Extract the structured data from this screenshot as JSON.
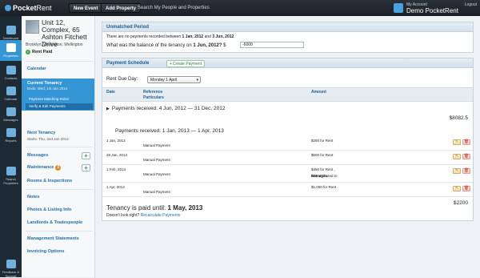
{
  "topbar": {
    "brand_name": "Pocket",
    "brand_suffix": "Rent",
    "new_event": "New Event",
    "add_property": "Add Property",
    "search_placeholder": "Search My People and Properties",
    "account_label": "My Account",
    "account_name": "Demo PocketRent",
    "logout": "Logout"
  },
  "left_nav": [
    {
      "label": "Dashboard",
      "icon": "dashboard-icon"
    },
    {
      "label": "Properties",
      "icon": "building-icon"
    },
    {
      "label": "Contacts",
      "icon": "people-icon"
    },
    {
      "label": "Calendar",
      "icon": "calendar-icon"
    },
    {
      "label": "Messages",
      "icon": "speech-bubble-icon"
    },
    {
      "label": "Reports",
      "icon": "chart-icon"
    },
    {
      "label": "Search Properties",
      "icon": "search-icon"
    },
    {
      "label": "Feedback & Support",
      "icon": "flag-icon"
    }
  ],
  "sidebar": {
    "property_title": "Unit 12, Complex, 65 Ashton Fitchett Drive",
    "property_address": "Brooklyn, Wellington, Wellington",
    "rent_status": "Rent Paid",
    "calendar": "Calendar",
    "current_tenancy": "Current Tenancy",
    "current_tenancy_ends": "Ends: Wed, 1st Jan 2014",
    "sub_payment_matching": "Payment Matching Rules",
    "sub_verify_edit": "Verify & Edit Payments",
    "next_tenancy": "Next Tenancy",
    "next_tenancy_starts": "Starts: Thu, 2nd Jan 2014",
    "messages": "Messages",
    "maintenance": "Maintenance",
    "maintenance_count": "2",
    "rooms_inspections": "Rooms & Inspections",
    "notes": "Notes",
    "photos_listing": "Photos & Listing Info",
    "landlords_tradespeople": "Landlords & Tradespeople",
    "management_statements": "Management Statements",
    "invoicing_options": "Invoicing Options"
  },
  "unmatched": {
    "title": "Unmatched Period",
    "notice_prefix": "There are no payments recorded between",
    "notice_from": "1 Jan, 2012",
    "notice_and": "and",
    "notice_to": "3 Jun, 2012",
    "question_prefix": "What was the balance of the tenancy on",
    "question_date": "1 Jun, 2012?",
    "currency": "$",
    "balance_value": "-6000"
  },
  "schedule": {
    "title": "Payment Schedule",
    "create_payment": "Create Payment",
    "rent_due_label": "Rent Due Day:",
    "rent_due_value": "Monday 1 April",
    "col_date": "Date",
    "col_reference": "Reference",
    "col_particulars": "Particulars",
    "col_amount": "Amount",
    "group1_label": "Payments received: 4 Jun, 2012 — 31 Dec, 2012",
    "group1_total": "$8082.5",
    "group2_label": "Payments received: 1 Jan, 2013 — 1 Apr, 2013",
    "rows": [
      {
        "date": "1 Jan, 2013",
        "particulars": "Manual Payment",
        "amount": "$250 for Rent",
        "amount_extra_prefix": "",
        "amount_extra_bold": ""
      },
      {
        "date": "28 Jan, 2013",
        "particulars": "Manual Payment",
        "amount": "$500 for Rent",
        "amount_extra_prefix": "",
        "amount_extra_bold": ""
      },
      {
        "date": "1 Feb, 2013",
        "particulars": "Manual Payment",
        "amount": "$450 for Rent ,",
        "amount_extra_prefix": "$50 attributed to",
        "amount_extra_bold": "Damages"
      },
      {
        "date": "1 Apr, 2013",
        "particulars": "Manual Payment",
        "amount": "$1,000 for Rent",
        "amount_extra_prefix": "",
        "amount_extra_bold": ""
      }
    ],
    "group2_total": "$2200",
    "paid_until_label": "Tenancy is paid until:",
    "paid_until_date": "1 May, 2013",
    "doesnt_look_right": "Doesn't look right?",
    "recalculate": "Recalculate Payments"
  }
}
